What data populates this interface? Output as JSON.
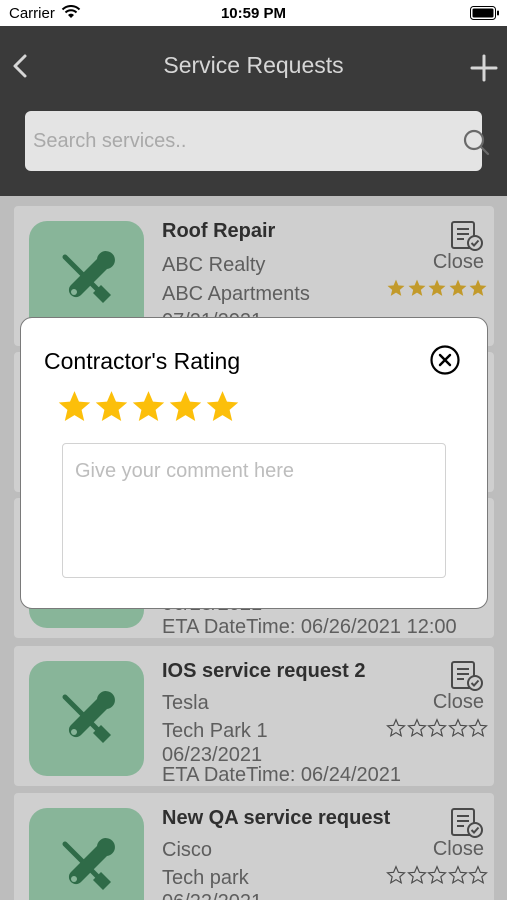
{
  "status_bar": {
    "carrier": "Carrier",
    "time": "10:59 PM"
  },
  "nav": {
    "title": "Service Requests",
    "back_icon": "chevron-left-icon",
    "add_icon": "plus-icon"
  },
  "search": {
    "placeholder": "Search services..",
    "value": ""
  },
  "colors": {
    "nav_bg": "#3a3a3a",
    "thumb_bg": "#88b599",
    "star_gold": "#f5b400",
    "icon_green": "#2f6b48"
  },
  "cards": [
    {
      "title": "Roof Repair",
      "company": "ABC Realty",
      "location": "ABC Apartments",
      "date": "07/21/2021",
      "eta": "",
      "status": "Close",
      "rating": 5
    },
    {
      "title": "",
      "company": "",
      "location": "",
      "date": "",
      "eta": "",
      "status": "",
      "rating": 0
    },
    {
      "title": "",
      "company": "",
      "location": "",
      "date": "06/23/2021",
      "eta": "ETA DateTime: 06/26/2021 12:00",
      "status": "",
      "rating": 0
    },
    {
      "title": "IOS service request 2",
      "company": "Tesla",
      "location": "Tech Park 1",
      "date": "06/23/2021",
      "eta": "ETA DateTime: 06/24/2021",
      "status": "Close",
      "rating": 0
    },
    {
      "title": "New QA service request",
      "company": "Cisco",
      "location": "Tech park",
      "date": "06/22/2021",
      "eta": "",
      "status": "Close",
      "rating": 0
    }
  ],
  "modal": {
    "title": "Contractor's Rating",
    "rating": 5,
    "comment_placeholder": "Give your comment here",
    "comment_value": ""
  }
}
